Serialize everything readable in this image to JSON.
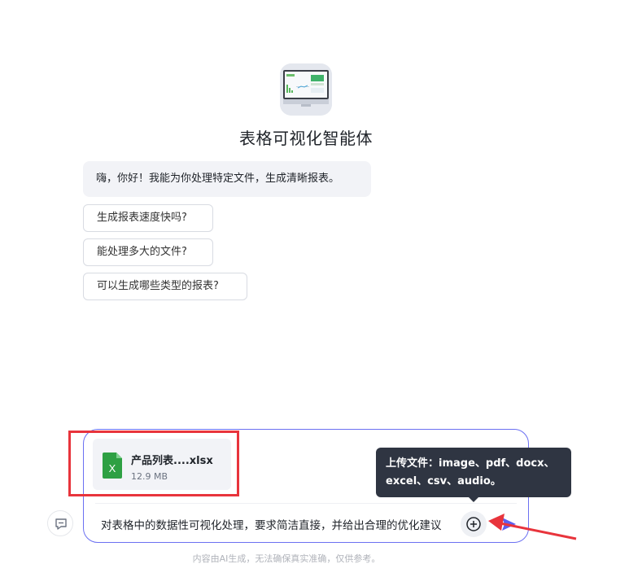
{
  "agent": {
    "avatar_icon": "chart-dashboard-icon",
    "title": "表格可视化智能体"
  },
  "greeting": "嗨，你好！我能为你处理特定文件，生成清晰报表。",
  "suggestions": [
    "生成报表速度快吗?",
    "能处理多大的文件?",
    "可以生成哪些类型的报表?"
  ],
  "attachment": {
    "icon": "excel-file-icon",
    "name": "产品列表....xlsx",
    "size": "12.9 MB"
  },
  "tooltip": {
    "line1": "上传文件：image、pdf、docx、",
    "line2": "excel、csv、audio。"
  },
  "input": {
    "value": "对表格中的数据性可视化处理，要求简洁直接，并给出合理的优化建议"
  },
  "icons": {
    "new_chat": "new-chat-icon",
    "upload": "plus-circle-icon",
    "send": "send-icon"
  },
  "colors": {
    "composer_border": "#6b70f2",
    "highlight": "#e8343c",
    "tooltip_bg": "#2f3542",
    "excel_green": "#2ea043"
  },
  "disclaimer": "内容由AI生成，无法确保真实准确，仅供参考。"
}
